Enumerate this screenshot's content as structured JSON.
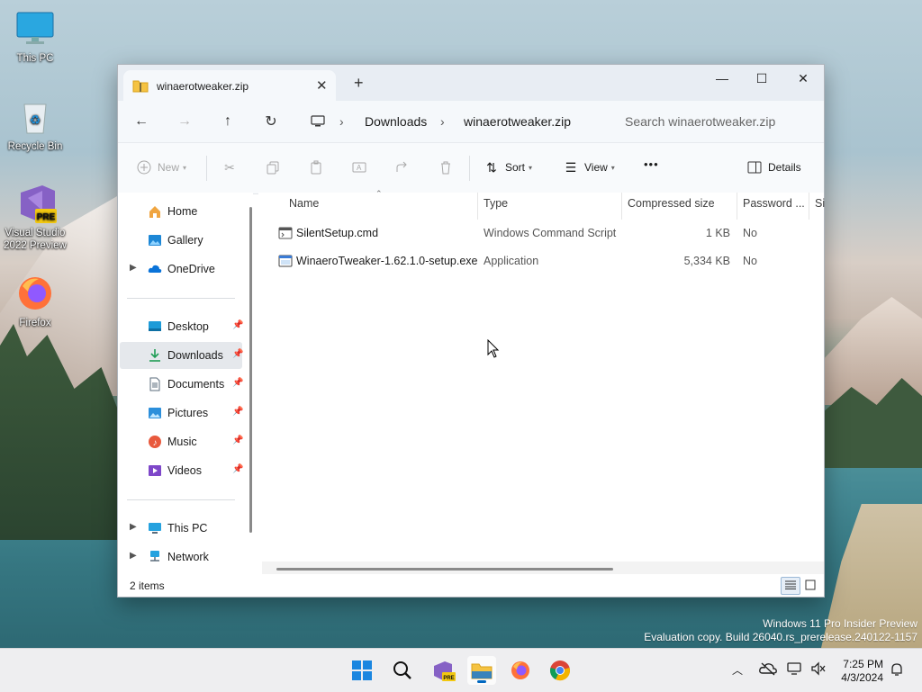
{
  "desktop": {
    "icons": [
      {
        "label": "This PC"
      },
      {
        "label": "Recycle Bin"
      },
      {
        "label_line1": "Visual Studio",
        "label_line2": "2022 Preview",
        "badge": "PRE"
      },
      {
        "label": "Firefox"
      }
    ],
    "watermark": {
      "line1": "Windows 11 Pro Insider Preview",
      "line2": "Evaluation copy. Build 26040.rs_prerelease.240122-1157"
    }
  },
  "window": {
    "tab_title": "winaerotweaker.zip",
    "tab_close_glyph": "✕",
    "new_tab_glyph": "+",
    "controls": {
      "minimize": "—",
      "maximize": "☐",
      "close": "✕"
    },
    "nav": {
      "back": "←",
      "forward": "→",
      "up": "↑",
      "refresh": "↻"
    },
    "breadcrumb": {
      "sep1": "›",
      "item1": "Downloads",
      "sep2": "›",
      "item2": "winaerotweaker.zip"
    },
    "search_placeholder": "Search winaerotweaker.zip",
    "commands": {
      "new": "New",
      "sort": "Sort",
      "view": "View",
      "more": "•••",
      "details": "Details"
    },
    "nav_pane": {
      "group1": [
        "Home",
        "Gallery",
        "OneDrive"
      ],
      "group2": [
        "Desktop",
        "Downloads",
        "Documents",
        "Pictures",
        "Music",
        "Videos"
      ],
      "group3": [
        "This PC",
        "Network"
      ],
      "selected": "Downloads"
    },
    "columns": [
      "Name",
      "Type",
      "Compressed size",
      "Password ...",
      "Si"
    ],
    "files": [
      {
        "name": "SilentSetup.cmd",
        "type": "Windows Command Script",
        "compressed_size": "1 KB",
        "password": "No"
      },
      {
        "name": "WinaeroTweaker-1.62.1.0-setup.exe",
        "type": "Application",
        "compressed_size": "5,334 KB",
        "password": "No"
      }
    ],
    "status": "2 items"
  },
  "taskbar": {
    "time": "7:25 PM",
    "date": "4/3/2024",
    "badge": "PRE"
  },
  "colors": {
    "accent": "#0067c0",
    "selection": "#e5e8ec",
    "titlebar": "#e8edf3"
  }
}
